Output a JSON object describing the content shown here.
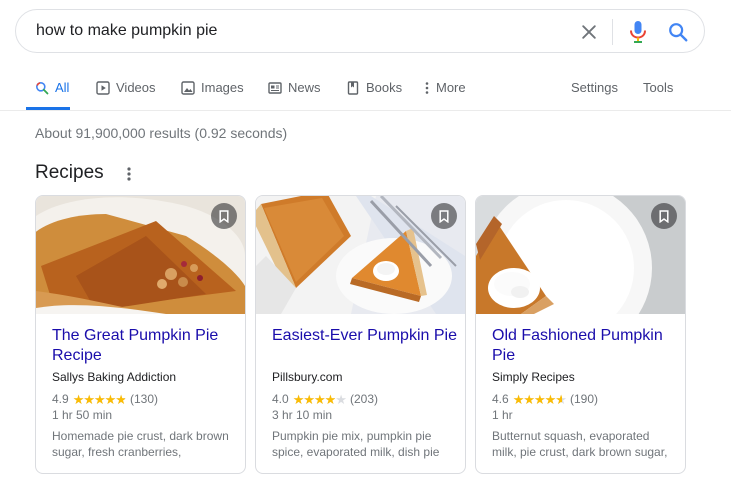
{
  "search": {
    "query": "how to make pumpkin pie"
  },
  "tabs": [
    {
      "label": "All",
      "icon": "search-icon",
      "active": true
    },
    {
      "label": "Videos",
      "icon": "video-icon"
    },
    {
      "label": "Images",
      "icon": "image-icon"
    },
    {
      "label": "News",
      "icon": "news-icon"
    },
    {
      "label": "Books",
      "icon": "book-icon"
    },
    {
      "label": "More",
      "icon": "more-vert-icon"
    },
    {
      "label": "Settings"
    },
    {
      "label": "Tools"
    }
  ],
  "result_stats": "About 91,900,000 results (0.92 seconds)",
  "recipes": {
    "title": "Recipes",
    "cards": [
      {
        "title": "The Great Pumpkin Pie Recipe",
        "source": "Sallys Baking Addiction",
        "rating": "4.9",
        "rating_value": 4.9,
        "reviews": "(130)",
        "time": "1 hr 50 min",
        "ingredients": "Homemade pie crust, dark brown sugar, fresh cranberries,"
      },
      {
        "title": "Easiest-Ever Pumpkin Pie",
        "source": "Pillsbury.com",
        "rating": "4.0",
        "rating_value": 4.0,
        "reviews": "(203)",
        "time": "3 hr 10 min",
        "ingredients": "Pumpkin pie mix, pumpkin pie spice, evaporated milk, dish pie"
      },
      {
        "title": "Old Fashioned Pumpkin Pie",
        "source": "Simply Recipes",
        "rating": "4.6",
        "rating_value": 4.6,
        "reviews": "(190)",
        "time": "1 hr",
        "ingredients": "Butternut squash, evaporated milk, pie crust, dark brown sugar,"
      }
    ]
  },
  "stars": "★★★★★",
  "colors": {
    "link": "#1a0dab",
    "accent": "#1a73e8",
    "star": "#fbbc04"
  }
}
